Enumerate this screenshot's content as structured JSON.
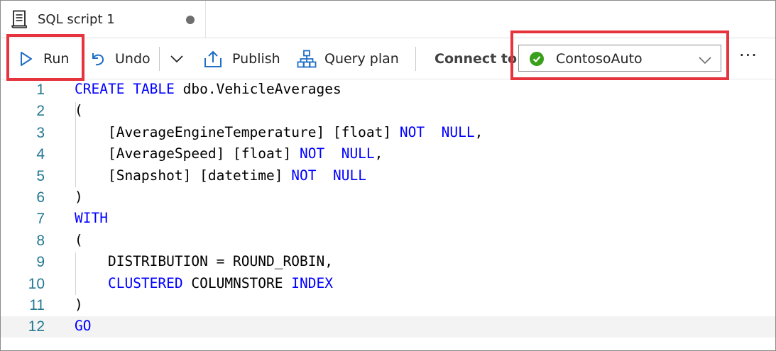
{
  "tab": {
    "title": "SQL script 1",
    "icon": "script-document-icon",
    "unsaved_dot": true
  },
  "toolbar": {
    "run_label": "Run",
    "undo_label": "Undo",
    "publish_label": "Publish",
    "query_plan_label": "Query plan",
    "connect_label": "Connect to",
    "connection": {
      "value": "ContosoAuto",
      "status_color": "#3a9f1a"
    },
    "more_label": "···"
  },
  "colors": {
    "highlight": "#e5343e",
    "keyword": "#0000ff",
    "line_number": "#237893"
  },
  "editor": {
    "lines": [
      {
        "n": "1",
        "tokens": [
          [
            "kw",
            "CREATE"
          ],
          [
            "t",
            " "
          ],
          [
            "kw",
            "TABLE"
          ],
          [
            "t",
            " dbo.VehicleAverages"
          ]
        ]
      },
      {
        "n": "2",
        "tokens": [
          [
            "t",
            "("
          ]
        ]
      },
      {
        "n": "3",
        "tokens": [
          [
            "t",
            "    [AverageEngineTemperature] [float] "
          ],
          [
            "kw",
            "NOT"
          ],
          [
            "t",
            "  "
          ],
          [
            "kw",
            "NULL"
          ],
          [
            "t",
            ","
          ]
        ]
      },
      {
        "n": "4",
        "tokens": [
          [
            "t",
            "    [AverageSpeed] [float] "
          ],
          [
            "kw",
            "NOT"
          ],
          [
            "t",
            "  "
          ],
          [
            "kw",
            "NULL"
          ],
          [
            "t",
            ","
          ]
        ]
      },
      {
        "n": "5",
        "tokens": [
          [
            "t",
            "    [Snapshot] [datetime] "
          ],
          [
            "kw",
            "NOT"
          ],
          [
            "t",
            "  "
          ],
          [
            "kw",
            "NULL"
          ]
        ]
      },
      {
        "n": "6",
        "tokens": [
          [
            "t",
            ")"
          ]
        ]
      },
      {
        "n": "7",
        "tokens": [
          [
            "kw",
            "WITH"
          ]
        ]
      },
      {
        "n": "8",
        "tokens": [
          [
            "t",
            "("
          ]
        ]
      },
      {
        "n": "9",
        "tokens": [
          [
            "t",
            "    DISTRIBUTION = ROUND_ROBIN,"
          ]
        ]
      },
      {
        "n": "10",
        "tokens": [
          [
            "t",
            "    "
          ],
          [
            "kw",
            "CLUSTERED"
          ],
          [
            "t",
            " COLUMNSTORE "
          ],
          [
            "kw",
            "INDEX"
          ]
        ]
      },
      {
        "n": "11",
        "tokens": [
          [
            "t",
            ")"
          ]
        ]
      },
      {
        "n": "12",
        "tokens": [
          [
            "kw",
            "GO"
          ]
        ]
      }
    ],
    "current_line": "12"
  }
}
